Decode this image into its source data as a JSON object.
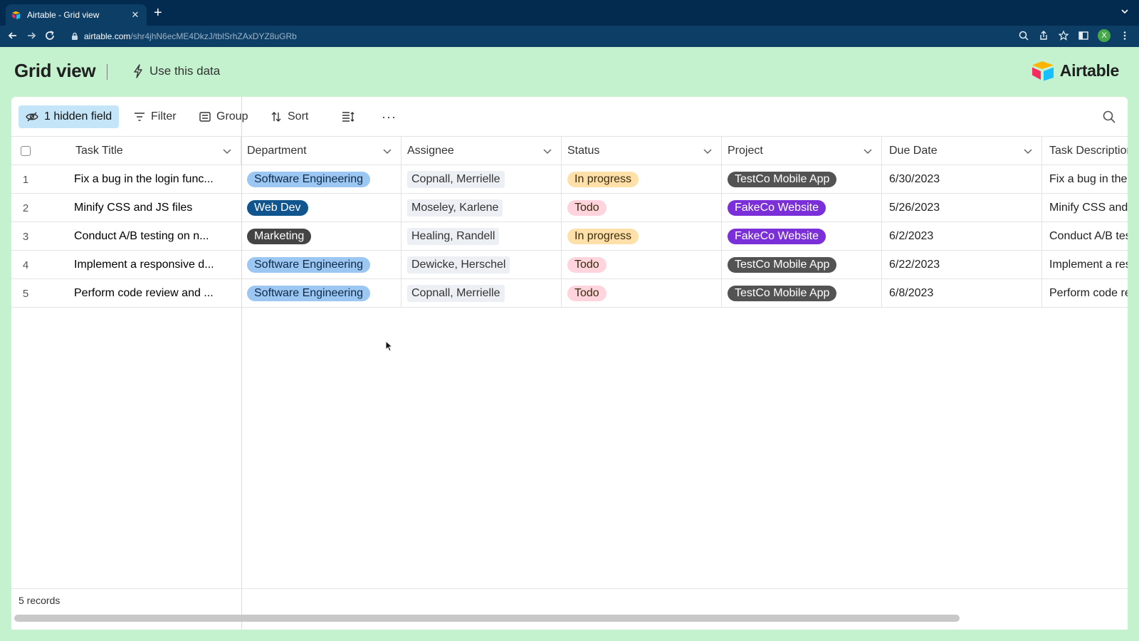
{
  "browser": {
    "tab_title": "Airtable - Grid view",
    "close_glyph": "✕",
    "new_tab_glyph": "+",
    "url_host": "airtable.com",
    "url_path": "/shr4jhN6ecME4DkzJ/tblSrhZAxDYZ8uGRb",
    "profile_initial": "X"
  },
  "header": {
    "title": "Grid view",
    "use_data_label": "Use this data",
    "brand_name": "Airtable"
  },
  "toolbar": {
    "hidden_fields_label": "1 hidden field",
    "filter_label": "Filter",
    "group_label": "Group",
    "sort_label": "Sort",
    "more_label": "···"
  },
  "columns": {
    "title": "Task Title",
    "department": "Department",
    "assignee": "Assignee",
    "status": "Status",
    "project": "Project",
    "due_date": "Due Date",
    "description": "Task Description"
  },
  "colors": {
    "dept_software_engineering": "#9cc7f2",
    "dept_web_dev": "#11558f",
    "dept_marketing": "#444444",
    "status_in_progress": "#ffe0a8",
    "status_todo": "#ffd4dc",
    "project_testco": "#535353",
    "project_fakeco": "#7a2fd8"
  },
  "rows": [
    {
      "num": "1",
      "title": "Fix a bug in the login func...",
      "department": "Software Engineering",
      "dept_color": "#9cc7f2",
      "dept_text": "#0e2a47",
      "assignee": "Copnall, Merrielle",
      "status": "In progress",
      "status_color": "#ffe0a8",
      "project": "TestCo Mobile App",
      "project_color": "#535353",
      "due": "6/30/2023",
      "desc": "Fix a bug in the lo"
    },
    {
      "num": "2",
      "title": "Minify CSS and JS files",
      "department": "Web Dev",
      "dept_color": "#11558f",
      "dept_text": "#ffffff",
      "assignee": "Moseley, Karlene",
      "status": "Todo",
      "status_color": "#ffd4dc",
      "project": "FakeCo Website",
      "project_color": "#7a2fd8",
      "due": "5/26/2023",
      "desc": "Minify CSS and JS"
    },
    {
      "num": "3",
      "title": "Conduct A/B testing on n...",
      "department": "Marketing",
      "dept_color": "#444444",
      "dept_text": "#ffffff",
      "assignee": "Healing, Randell",
      "status": "In progress",
      "status_color": "#ffe0a8",
      "project": "FakeCo Website",
      "project_color": "#7a2fd8",
      "due": "6/2/2023",
      "desc": "Conduct A/B test"
    },
    {
      "num": "4",
      "title": "Implement a responsive d...",
      "department": "Software Engineering",
      "dept_color": "#9cc7f2",
      "dept_text": "#0e2a47",
      "assignee": "Dewicke, Herschel",
      "status": "Todo",
      "status_color": "#ffd4dc",
      "project": "TestCo Mobile App",
      "project_color": "#535353",
      "due": "6/22/2023",
      "desc": "Implement a resp"
    },
    {
      "num": "5",
      "title": "Perform code review and ...",
      "department": "Software Engineering",
      "dept_color": "#9cc7f2",
      "dept_text": "#0e2a47",
      "assignee": "Copnall, Merrielle",
      "status": "Todo",
      "status_color": "#ffd4dc",
      "project": "TestCo Mobile App",
      "project_color": "#535353",
      "due": "6/8/2023",
      "desc": "Perform code rev"
    }
  ],
  "footer": {
    "records_label": "5 records"
  }
}
